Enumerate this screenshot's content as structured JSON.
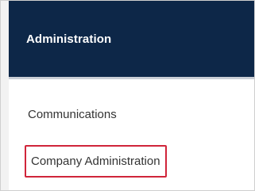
{
  "header": {
    "title": "Administration"
  },
  "menu": {
    "items": [
      {
        "label": "Communications"
      },
      {
        "label": "Company Administration",
        "highlighted": true
      }
    ]
  },
  "colors": {
    "header_bg": "#0d2748",
    "highlight_border": "#d0253a"
  }
}
